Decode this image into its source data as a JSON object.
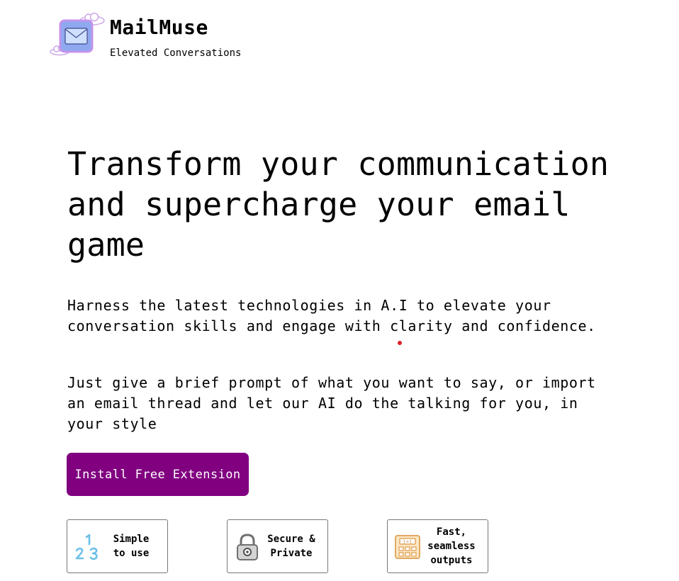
{
  "brand": {
    "name": "MailMuse",
    "tagline": "Elevated Conversations",
    "logo_icon": "envelope-with-clouds-icon"
  },
  "hero": {
    "title": "Transform your communication and supercharge your email game",
    "paragraph_1": "Harness the latest technologies in A.I to elevate your conversation skills and engage with clarity and confidence.",
    "paragraph_2": "Just give a brief prompt of what you want to say, or import an email thread and let our AI do the talking for you, in your style"
  },
  "cta": {
    "label": "Install Free Extension",
    "color": "#800080"
  },
  "features": [
    {
      "icon": "numbers-123-icon",
      "label": "Simple\nto use"
    },
    {
      "icon": "padlock-icon",
      "label": "Secure &\nPrivate"
    },
    {
      "icon": "calculator-icon",
      "label": "Fast,\nseamless\noutputs"
    }
  ]
}
